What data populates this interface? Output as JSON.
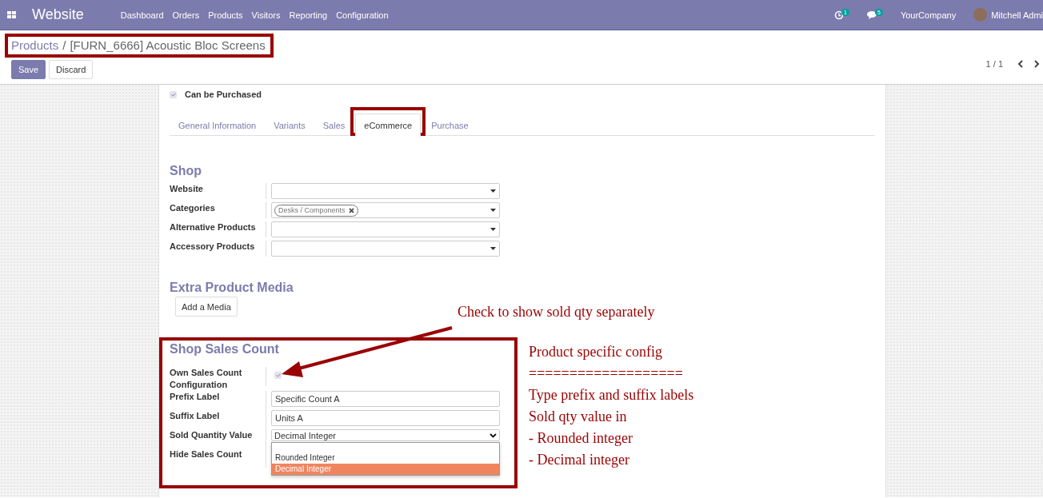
{
  "navbar": {
    "app_name": "Website",
    "menu": [
      "Dashboard",
      "Orders",
      "Products",
      "Visitors",
      "Reporting",
      "Configuration"
    ],
    "activity_count": "1",
    "message_count": "5",
    "company": "YourCompany",
    "user": "Mitchell Admi"
  },
  "breadcrumb": {
    "highlighted": true,
    "separator": "/",
    "items": [
      "Products",
      "[FURN_6666] Acoustic Bloc Screens"
    ]
  },
  "buttons": [
    {
      "label": "Save",
      "kind": "primary"
    },
    {
      "label": "Discard",
      "kind": "secondary"
    }
  ],
  "pager": "1 / 1",
  "can_be_purchased": {
    "label": "Can be Purchased",
    "checked": true
  },
  "tabs": [
    {
      "label": "General Information",
      "selected": false,
      "highlighted": false
    },
    {
      "label": "Variants",
      "selected": false,
      "highlighted": false
    },
    {
      "label": "Sales",
      "selected": false,
      "highlighted": false
    },
    {
      "label": "eCommerce",
      "selected": true,
      "highlighted": true
    },
    {
      "label": "Purchase",
      "selected": false,
      "highlighted": false
    }
  ],
  "shop": {
    "title": "Shop",
    "fields": [
      {
        "label": "Website",
        "kind": "many2one"
      },
      {
        "label": "Categories",
        "kind": "many2one",
        "tags": [
          "Desks / Components"
        ]
      },
      {
        "label": "Alternative Products",
        "kind": "many2one"
      },
      {
        "label": "Accessory Products",
        "kind": "many2one"
      }
    ]
  },
  "media": {
    "title": "Extra Product Media",
    "button": "Add a Media"
  },
  "sales_count": {
    "title": "Shop Sales Count",
    "highlighted": true,
    "fields": [
      {
        "label": "Own Sales Count Configuration",
        "kind": "checkbox",
        "checked": true
      },
      {
        "label": "Prefix Label",
        "kind": "text",
        "value": "Specific Count A"
      },
      {
        "label": "Suffix Label",
        "kind": "text",
        "value": "Units A"
      },
      {
        "label": "Sold Quantity Value",
        "kind": "select",
        "value": "Decimal Integer",
        "open": true,
        "options": [
          {
            "label": "Rounded Integer",
            "selected": false
          },
          {
            "label": "Decimal Integer",
            "selected": true
          }
        ]
      },
      {
        "label": "Hide Sales Count",
        "kind": "covered"
      }
    ]
  },
  "annotations": {
    "arrow_note": "Check to show sold qty separately",
    "notes": [
      "Product specific config",
      "===================",
      "Type prefix and suffix labels",
      "Sold qty value in",
      "- Rounded integer",
      "- Decimal integer"
    ]
  }
}
